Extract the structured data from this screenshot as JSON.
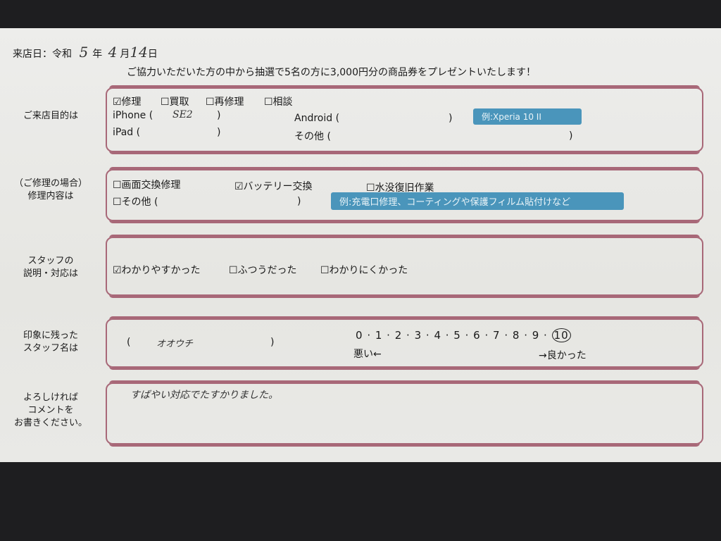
{
  "header": {
    "visit_label": "来店日：令和",
    "year": "5",
    "year_unit": "年",
    "month": "4",
    "month_unit": "月",
    "day": "14",
    "day_unit": "日",
    "campaign": "ご協力いただいた方の中から抽選で5名の方に3,000円分の商品券をプレゼントいたします！"
  },
  "purpose": {
    "label": "ご来店目的は",
    "options": [
      "☑修理",
      "☐買取",
      "☐再修理",
      "☐相談"
    ],
    "iphone_label": "iPhone (",
    "iphone_value": "SE2",
    "close": ")",
    "android_label": "Android (",
    "ipad_label": "iPad (",
    "other_label": "その他 (",
    "hint": "例:Xperia 10 II"
  },
  "repair": {
    "label_line1": "（ご修理の場合）",
    "label_line2": "修理内容は",
    "options": [
      "☐画面交換修理",
      "☑バッテリー交換",
      "☐水没復旧作業"
    ],
    "other_label": "☐その他 (",
    "close": ")",
    "hint": "例:充電口修理、コーティングや保護フィルム貼付けなど"
  },
  "staff_explanation": {
    "label_line1": "スタッフの",
    "label_line2": "説明・対応は",
    "options": [
      "☑わかりやすかった",
      "☐ふつうだった",
      "☐わかりにくかった"
    ]
  },
  "staff_name": {
    "label_line1": "印象に残った",
    "label_line2": "スタッフ名は",
    "open": "(",
    "value": "オオウチ",
    "close": ")",
    "scale": [
      "0",
      "1",
      "2",
      "3",
      "4",
      "5",
      "6",
      "7",
      "8",
      "9",
      "10"
    ],
    "selected": "10",
    "bad": "悪い←",
    "good": "→良かった"
  },
  "comment": {
    "label_line1": "よろしければ",
    "label_line2": "コメントを",
    "label_line3": "お書きください。",
    "value": "すばやい対応でたすかりました。"
  }
}
